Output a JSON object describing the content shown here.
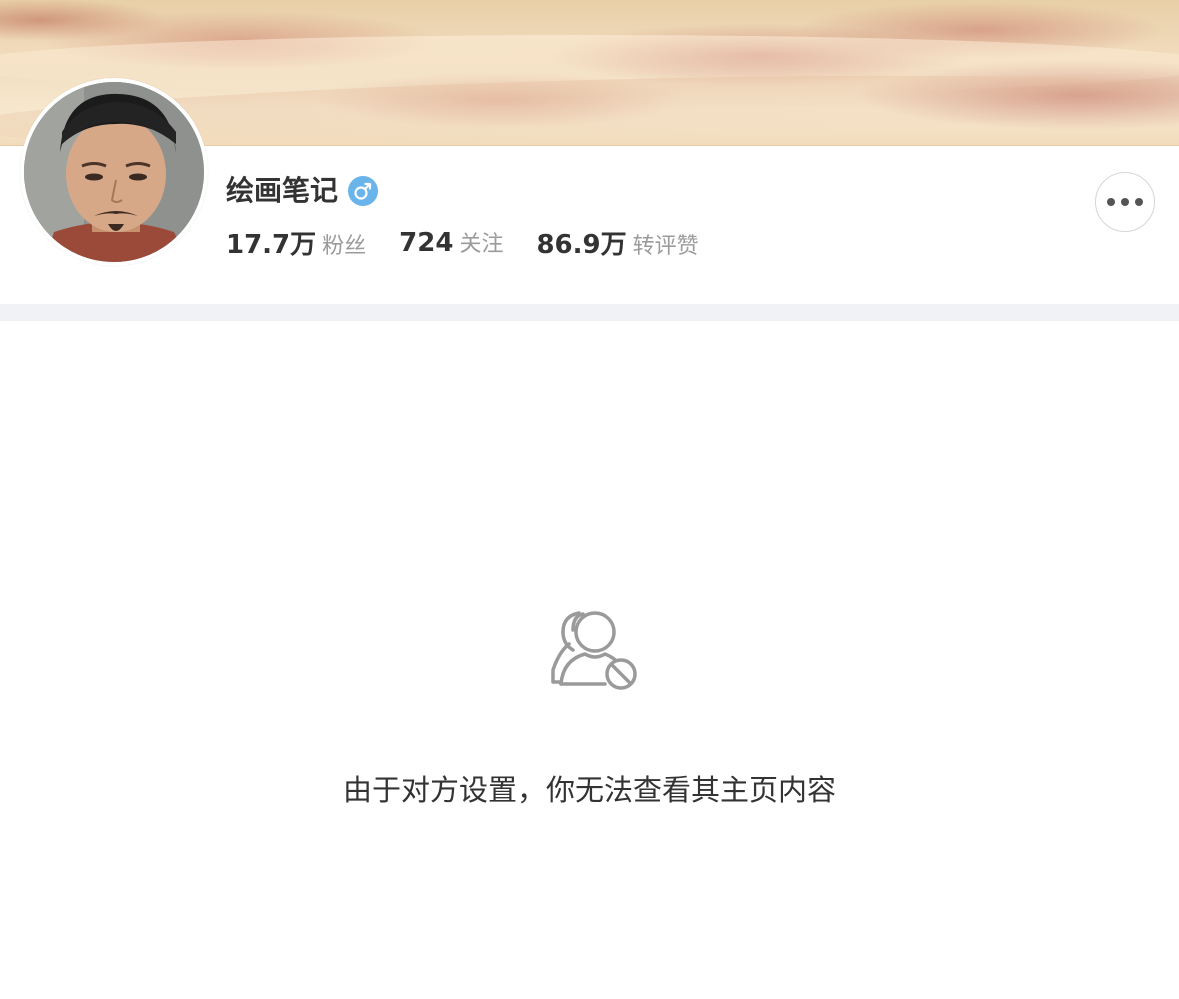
{
  "profile": {
    "name": "绘画笔记",
    "gender_icon": "male-icon",
    "gender_color": "#6ab4ec",
    "stats": [
      {
        "value": "17.7万",
        "label": "粉丝"
      },
      {
        "value": "724",
        "label": "关注"
      },
      {
        "value": "86.9万",
        "label": "转评赞"
      }
    ]
  },
  "actions": {
    "more_icon": "more-options-icon"
  },
  "empty_state": {
    "icon": "user-blocked-icon",
    "message": "由于对方设置，你无法查看其主页内容"
  }
}
